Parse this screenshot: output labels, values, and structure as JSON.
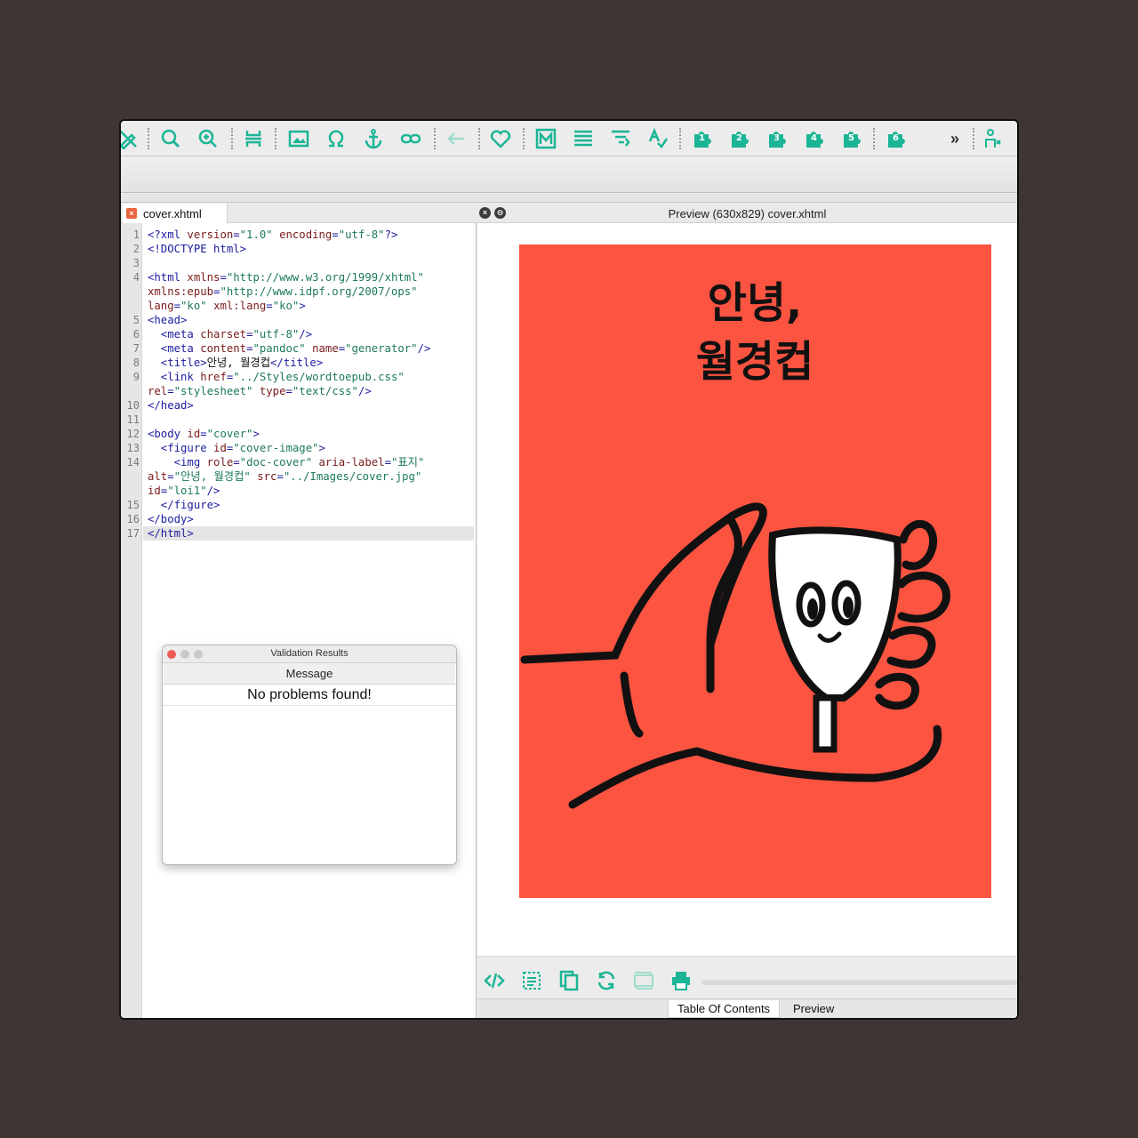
{
  "toolbar": {
    "accent": "#1bb596",
    "icons": [
      "edit-icon",
      "search-icon",
      "zoom-icon",
      "split-icon",
      "image-icon",
      "omega-icon",
      "anchor-icon",
      "link-icon",
      "back-arrow-icon",
      "heart-icon",
      "markdown-icon",
      "list-icon",
      "indent-icon",
      "spellcheck-icon",
      "plugin-1-icon",
      "plugin-2-icon",
      "plugin-3-icon",
      "plugin-4-icon",
      "plugin-5-icon",
      "plugin-6-icon",
      "more-icon",
      "person-icon"
    ],
    "plugin_numbers": [
      "1",
      "2",
      "3",
      "4",
      "5",
      "6"
    ],
    "more_label": "»"
  },
  "editor": {
    "tab_label": "cover.xhtml",
    "line_numbers": [
      "1",
      "2",
      "3",
      "4",
      "5",
      "6",
      "7",
      "8",
      "9",
      "10",
      "11",
      "12",
      "13",
      "14",
      "15",
      "16",
      "17"
    ],
    "lines": [
      "<?xml version=\"1.0\" encoding=\"utf-8\"?>",
      "<!DOCTYPE html>",
      "",
      "<html xmlns=\"http://www.w3.org/1999/xhtml\"",
      "xmlns:epub=\"http://www.idpf.org/2007/ops\"",
      "lang=\"ko\" xml:lang=\"ko\">",
      "<head>",
      "  <meta charset=\"utf-8\"/>",
      "  <meta content=\"pandoc\" name=\"generator\"/>",
      "  <title>안녕, 월경컵</title>",
      "  <link href=\"../Styles/wordtoepub.css\"",
      "rel=\"stylesheet\" type=\"text/css\"/>",
      "</head>",
      "",
      "<body id=\"cover\">",
      "  <figure id=\"cover-image\">",
      "    <img role=\"doc-cover\" aria-label=\"표지\"",
      "alt=\"안녕, 월경컵\" src=\"../Images/cover.jpg\"",
      "id=\"loi1\"/>",
      "  </figure>",
      "</body>",
      "</html>"
    ]
  },
  "validation": {
    "title": "Validation Results",
    "header": "Message",
    "message": "No problems found!"
  },
  "preview": {
    "title": "Preview (630x829) cover.xhtml",
    "cover_title_line1": "안녕,",
    "cover_title_line2": "월경컵",
    "cover_color": "#fb5441",
    "toolbar_icons": [
      "code-icon",
      "select-icon",
      "copy-icon",
      "refresh-icon",
      "css-icon",
      "print-icon"
    ]
  },
  "bottom_tabs": {
    "toc": "Table Of Contents",
    "preview": "Preview"
  }
}
